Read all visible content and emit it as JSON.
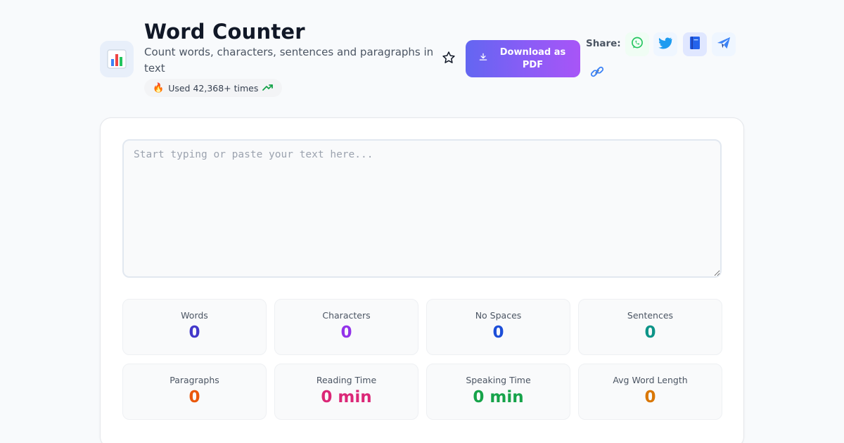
{
  "header": {
    "app_icon": "bar-chart-icon",
    "title": "Word Counter",
    "subtitle": "Count words, characters, sentences and paragraphs in text",
    "usage": {
      "icon": "fire-icon",
      "text": "Used 42,368+ times",
      "trend_icon": "trending-up-icon"
    }
  },
  "actions": {
    "favorite_icon": "star-icon",
    "download_label": "Download as PDF",
    "download_icon": "download-icon",
    "share_label": "Share:",
    "share_icons": [
      "whatsapp-icon",
      "twitter-icon",
      "facebook-icon",
      "telegram-icon",
      "link-icon"
    ]
  },
  "editor": {
    "placeholder": "Start typing or paste your text here...",
    "value": ""
  },
  "stats": [
    {
      "label": "Words",
      "value": "0",
      "color": "#4338ca"
    },
    {
      "label": "Characters",
      "value": "0",
      "color": "#9333ea"
    },
    {
      "label": "No Spaces",
      "value": "0",
      "color": "#1d4ed8"
    },
    {
      "label": "Sentences",
      "value": "0",
      "color": "#0d9488"
    },
    {
      "label": "Paragraphs",
      "value": "0",
      "color": "#ea580c"
    },
    {
      "label": "Reading Time",
      "value": "0 min",
      "color": "#db2777"
    },
    {
      "label": "Speaking Time",
      "value": "0 min",
      "color": "#16a34a"
    },
    {
      "label": "Avg Word Length",
      "value": "0",
      "color": "#d97706"
    }
  ],
  "colors": {
    "accent_start": "#6366f1",
    "accent_end": "#a855f7",
    "background": "#f8fafc"
  }
}
